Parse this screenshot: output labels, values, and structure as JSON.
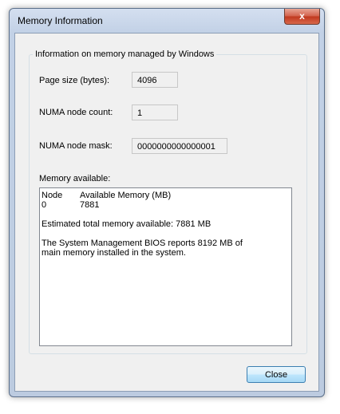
{
  "window": {
    "title": "Memory Information",
    "close_glyph": "x"
  },
  "group": {
    "label": "Information on memory managed by Windows"
  },
  "fields": {
    "page_size": {
      "label": "Page size (bytes):",
      "value": "4096"
    },
    "numa_count": {
      "label": "NUMA node count:",
      "value": "1"
    },
    "numa_mask": {
      "label": "NUMA node mask:",
      "value": "0000000000000001"
    }
  },
  "memory": {
    "label": "Memory available:",
    "header": {
      "node": "Node",
      "available": "Available Memory (MB)"
    },
    "rows": [
      {
        "node": "0",
        "available": "7881"
      }
    ],
    "estimated": "Estimated total memory available: 7881 MB",
    "bios_line1": "The System Management BIOS reports 8192 MB of",
    "bios_line2": "main memory installed in the system."
  },
  "buttons": {
    "close": "Close"
  }
}
